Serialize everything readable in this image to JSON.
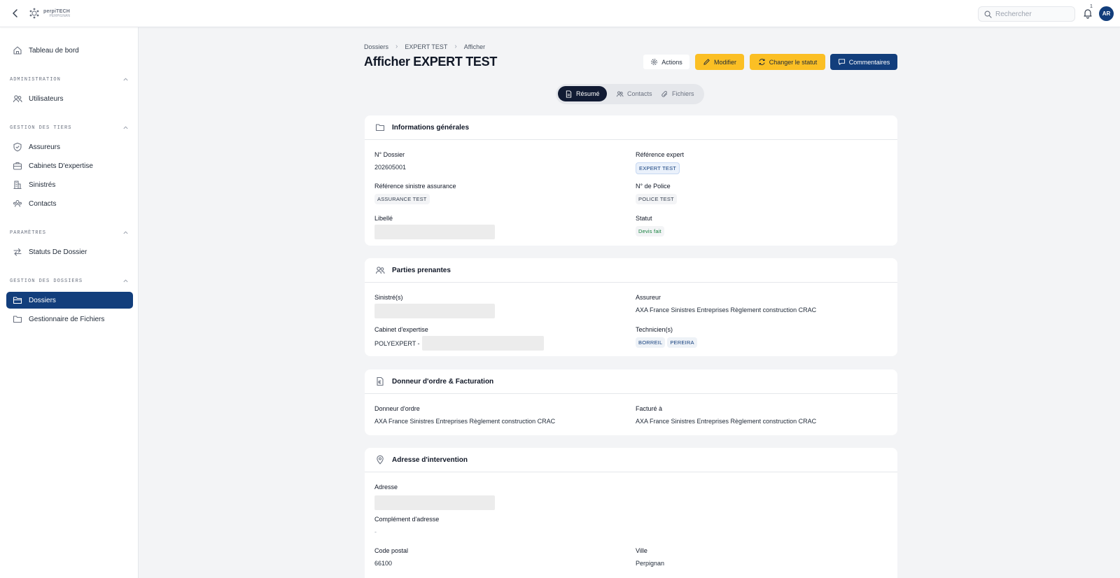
{
  "topbar": {
    "logo_line1": "perpiTECH",
    "logo_line2": "PERPIGNAN",
    "search_placeholder": "Rechercher",
    "notifications_count": "1",
    "avatar_initials": "AR"
  },
  "sidebar": {
    "dashboard": "Tableau de bord",
    "sections": {
      "admin": "ADMINISTRATION",
      "tiers": "GESTION DES TIERS",
      "params": "PARAMÈTRES",
      "dossiers": "GESTION DES DOSSIERS"
    },
    "items": {
      "utilisateurs": "Utilisateurs",
      "assureurs": "Assureurs",
      "cabinets": "Cabinets D'expertise",
      "sinistres": "Sinistrés",
      "contacts": "Contacts",
      "statuts": "Statuts De Dossier",
      "dossiers": "Dossiers",
      "fichiers": "Gestionnaire de Fichiers"
    }
  },
  "breadcrumb": [
    "Dossiers",
    "EXPERT TEST",
    "Afficher"
  ],
  "page_title": "Afficher EXPERT TEST",
  "buttons": {
    "actions": "Actions",
    "modifier": "Modifier",
    "changer_statut": "Changer le statut",
    "commentaires": "Commentaires"
  },
  "tabs": [
    "Résumé",
    "Contacts",
    "Fichiers"
  ],
  "general": {
    "title": "Informations générales",
    "dossier_label": "N° Dossier",
    "dossier_value": "202605001",
    "ref_expert_label": "Référence expert",
    "ref_expert_value": "EXPERT TEST",
    "ref_sinistre_label": "Référence sinistre assurance",
    "ref_sinistre_value": "ASSURANCE TEST",
    "police_label": "N° de Police",
    "police_value": "POLICE TEST",
    "libelle_label": "Libellé",
    "statut_label": "Statut",
    "statut_value": "Devis fait",
    "statut_color": "#15803d"
  },
  "parties": {
    "title": "Parties prenantes",
    "sinistres_label": "Sinistré(s)",
    "assureur_label": "Assureur",
    "assureur_value": "AXA France Sinistres Entreprises Règlement construction CRAC",
    "cabinet_label": "Cabinet d'expertise",
    "cabinet_value": "POLYEXPERT -",
    "techniciens_label": "Technicien(s)",
    "techniciens": [
      "BORREIL",
      "PEREIRA"
    ]
  },
  "facturation": {
    "title": "Donneur d'ordre & Facturation",
    "donneur_label": "Donneur d'ordre",
    "donneur_value": "AXA France Sinistres Entreprises Règlement construction CRAC",
    "facture_label": "Facturé à",
    "facture_value": "AXA France Sinistres Entreprises Règlement construction CRAC"
  },
  "adresse": {
    "title": "Adresse d'intervention",
    "adresse_label": "Adresse",
    "complement_label": "Complément d'adresse",
    "complement_value": "-",
    "cp_label": "Code postal",
    "cp_value": "66100",
    "ville_label": "Ville",
    "ville_value": "Perpignan"
  },
  "colors": {
    "primary": "#123e7c",
    "accent": "#fbbf24",
    "tab_active": "#111b33"
  }
}
